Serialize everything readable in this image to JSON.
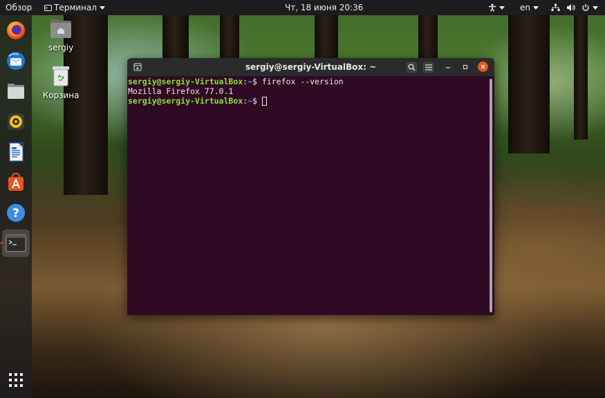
{
  "topbar": {
    "activities": "Обзор",
    "app_menu": "Терминал",
    "clock": "Чт, 18 июня  20:36",
    "language": "en"
  },
  "desktop": {
    "icons": [
      {
        "label": "sergiy",
        "icon": "home-folder-icon"
      },
      {
        "label": "Корзина",
        "icon": "trash-icon"
      }
    ]
  },
  "dock": {
    "items": [
      {
        "name": "firefox",
        "icon": "firefox-icon"
      },
      {
        "name": "thunderbird",
        "icon": "thunderbird-icon"
      },
      {
        "name": "files",
        "icon": "files-icon"
      },
      {
        "name": "rhythmbox",
        "icon": "rhythmbox-icon"
      },
      {
        "name": "libreoffice-writer",
        "icon": "writer-icon"
      },
      {
        "name": "software",
        "icon": "software-center-icon"
      },
      {
        "name": "help",
        "icon": "help-icon"
      },
      {
        "name": "terminal",
        "icon": "terminal-icon",
        "active": true
      },
      {
        "name": "show-applications",
        "icon": "app-grid-icon"
      }
    ]
  },
  "terminal": {
    "title": "sergiy@sergiy-VirtualBox: ~",
    "lines": [
      {
        "user": "sergiy@sergiy-VirtualBox",
        "colon": ":",
        "path": "~",
        "dollar": "$ ",
        "command": "firefox --version"
      },
      {
        "output": "Mozilla Firefox 77.0.1"
      },
      {
        "user": "sergiy@sergiy-VirtualBox",
        "colon": ":",
        "path": "~",
        "dollar": "$ ",
        "command": ""
      }
    ],
    "colors": {
      "background": "#300a24",
      "prompt_user": "#8ae234",
      "prompt_path": "#729fcf",
      "text": "#eeeeec"
    }
  },
  "accent_colors": {
    "ubuntu_orange": "#e95420",
    "close_button": "#e95420"
  }
}
